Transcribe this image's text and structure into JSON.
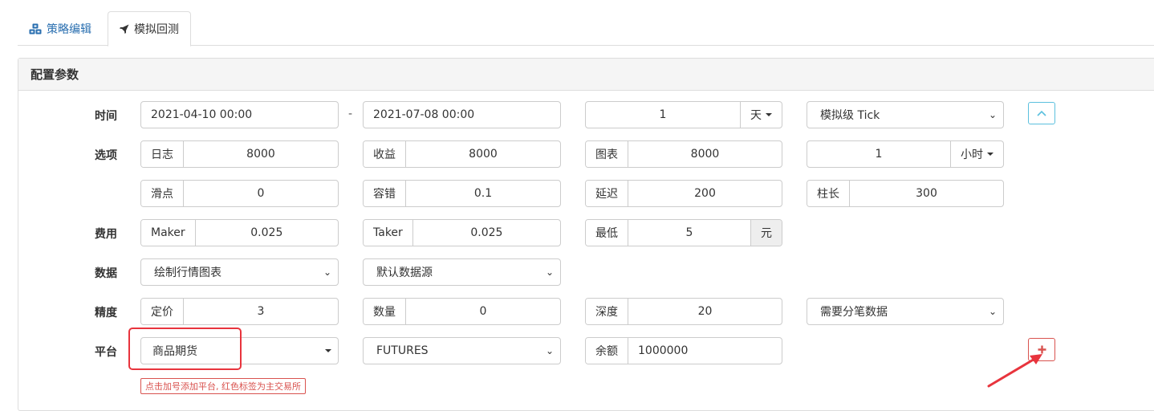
{
  "tabs": [
    {
      "label": "策略编辑",
      "icon": "cubes-icon"
    },
    {
      "label": "模拟回测",
      "icon": "rocket-icon"
    }
  ],
  "panel": {
    "title": "配置参数"
  },
  "rows": {
    "time": {
      "label": "时间",
      "start": "2021-04-10 00:00",
      "separator": "-",
      "end": "2021-07-08 00:00",
      "period_value": "1",
      "period_unit": "天",
      "tick_mode": "模拟级 Tick"
    },
    "options": {
      "label": "选项",
      "log_label": "日志",
      "log_value": "8000",
      "profit_label": "收益",
      "profit_value": "8000",
      "chart_label": "图表",
      "chart_value": "8000",
      "interval_value": "1",
      "interval_unit": "小时"
    },
    "options2": {
      "slippage_label": "滑点",
      "slippage_value": "0",
      "tolerance_label": "容错",
      "tolerance_value": "0.1",
      "delay_label": "延迟",
      "delay_value": "200",
      "bar_label": "柱长",
      "bar_value": "300"
    },
    "fees": {
      "label": "费用",
      "maker_label": "Maker",
      "maker_value": "0.025",
      "taker_label": "Taker",
      "taker_value": "0.025",
      "min_label": "最低",
      "min_value": "5",
      "min_unit": "元"
    },
    "data": {
      "label": "数据",
      "chart_mode": "绘制行情图表",
      "source": "默认数据源"
    },
    "precision": {
      "label": "精度",
      "price_label": "定价",
      "price_value": "3",
      "qty_label": "数量",
      "qty_value": "0",
      "depth_label": "深度",
      "depth_value": "20",
      "tick_data": "需要分笔数据"
    },
    "platform": {
      "label": "平台",
      "exchange": "商品期货",
      "market": "FUTURES",
      "balance_label": "余额",
      "balance_value": "1000000",
      "hint": "点击加号添加平台, 红色标签为主交易所"
    }
  },
  "colors": {
    "accent": "#2a6fb0",
    "danger": "#d9534f",
    "info": "#5bc0de",
    "highlight": "#e8343d"
  }
}
